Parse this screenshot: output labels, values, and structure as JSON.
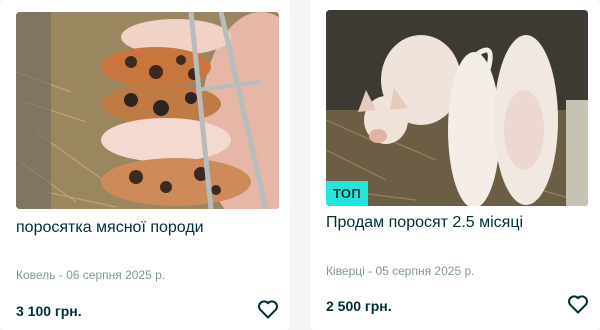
{
  "listings": [
    {
      "title": "поросятка мясної породи",
      "meta": "Ковель - 06 серпня 2025 р.",
      "price": "3 100 грн.",
      "badge": "",
      "favorite_icon": "heart-outline-icon"
    },
    {
      "title": "Продам поросят 2.5 місяці",
      "meta": "Ківерці - 05 серпня 2025 р.",
      "price": "2 500 грн.",
      "badge": "ТОП",
      "favorite_icon": "heart-outline-icon"
    }
  ],
  "colors": {
    "background": "#f2f4f5",
    "card": "#ffffff",
    "text": "#002f34",
    "meta": "#7f9799",
    "badge": "#23e5db"
  }
}
